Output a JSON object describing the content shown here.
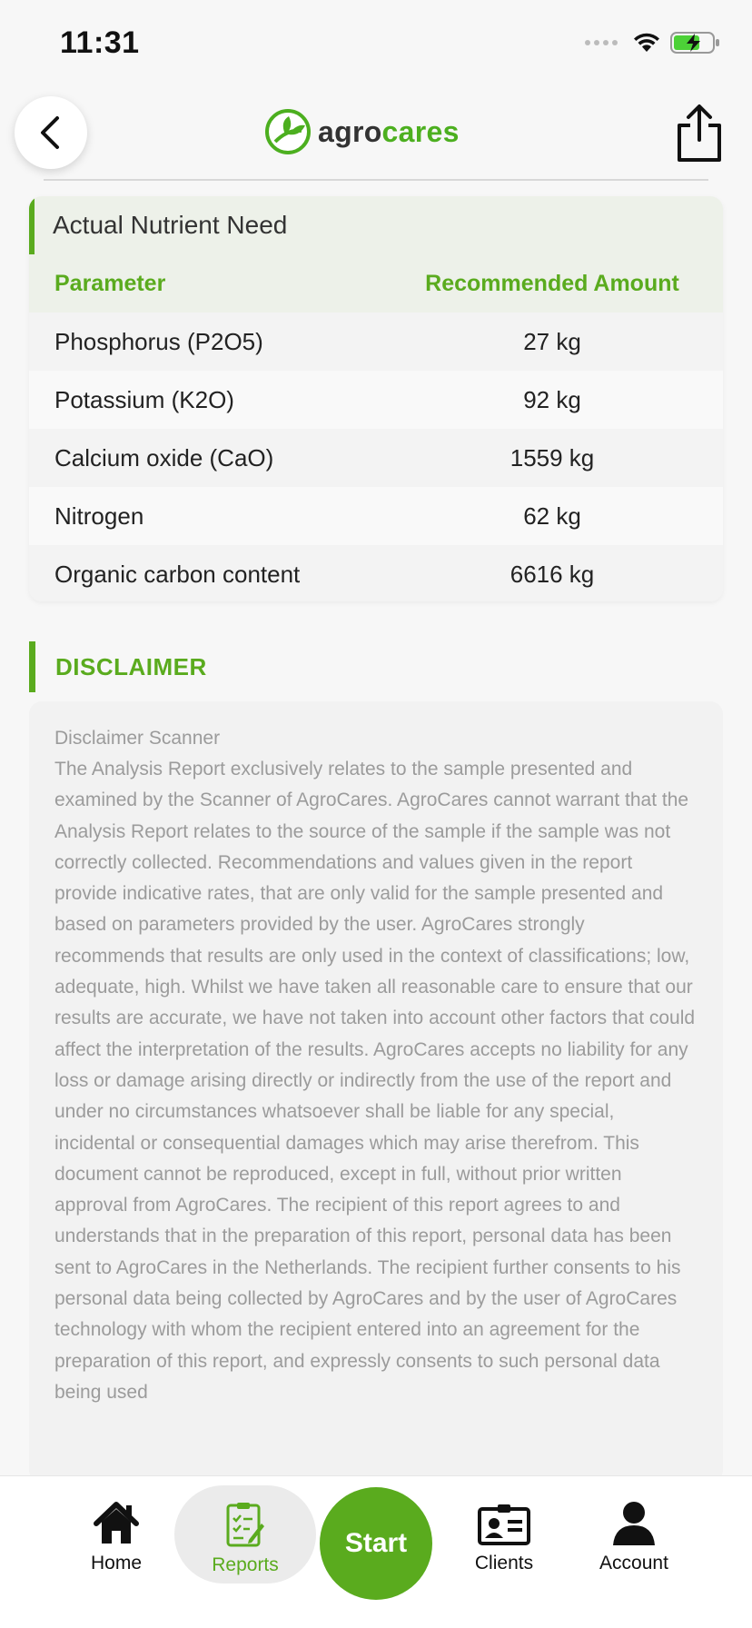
{
  "status": {
    "time": "11:31"
  },
  "header": {
    "logo_part1": "agro",
    "logo_part2": "cares"
  },
  "nutrient_card": {
    "title": "Actual Nutrient Need",
    "col_param": "Parameter",
    "col_amount": "Recommended Amount",
    "rows": [
      {
        "param": "Phosphorus (P2O5)",
        "amount": "27 kg"
      },
      {
        "param": "Potassium (K2O)",
        "amount": "92 kg"
      },
      {
        "param": "Calcium oxide (CaO)",
        "amount": "1559 kg"
      },
      {
        "param": "Nitrogen",
        "amount": "62 kg"
      },
      {
        "param": "Organic carbon content",
        "amount": "6616 kg"
      }
    ]
  },
  "disclaimer": {
    "heading": "DISCLAIMER",
    "subtitle": "Disclaimer Scanner",
    "body": "The Analysis Report exclusively relates to the sample presented and examined by the Scanner of AgroCares. AgroCares cannot warrant that the Analysis Report relates to the source of the sample if the sample was not correctly collected. Recommendations and values given in the report provide indicative rates, that are only valid for the sample presented and based on parameters provided by the user. AgroCares strongly recommends that results are only used in the context of classifications; low, adequate, high. Whilst we have taken all reasonable care to ensure that our results are accurate, we have not taken into account other factors that could affect the interpretation of the results. AgroCares accepts no liability for any loss or damage arising directly or indirectly from the use of the report and under no circumstances whatsoever shall be liable for any special, incidental or consequential damages which may arise therefrom. This document cannot be reproduced, except in full, without prior written approval from AgroCares. The recipient of this report agrees to and understands that in the preparation of this report, personal data has been sent to AgroCares in the Netherlands. The recipient further consents to his personal data being collected by AgroCares and by the user of AgroCares technology with whom the recipient entered into an agreement for the preparation of this report, and expressly consents to such personal data being used"
  },
  "tabbar": {
    "home": "Home",
    "reports": "Reports",
    "start": "Start",
    "clients": "Clients",
    "account": "Account"
  },
  "colors": {
    "brand_green": "#5aab1e",
    "logo_green": "#4caf1f"
  }
}
